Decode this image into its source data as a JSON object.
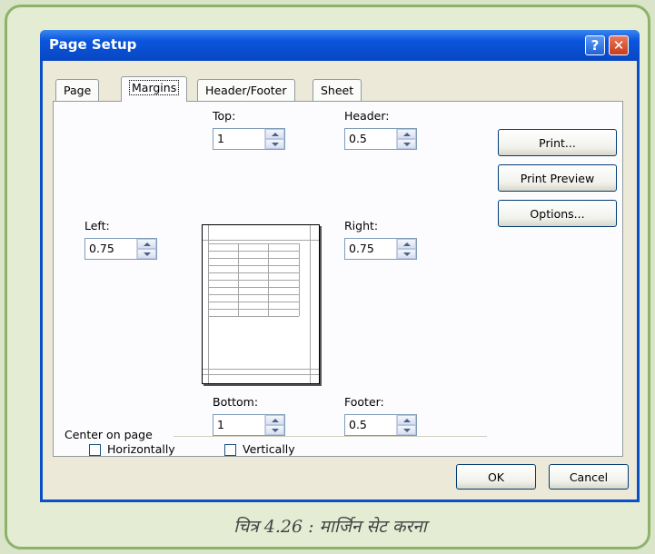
{
  "window": {
    "title": "Page Setup",
    "help_button": "?",
    "close_button": "✕"
  },
  "tabs": [
    {
      "label": "Page",
      "active": false
    },
    {
      "label": "Margins",
      "active": true
    },
    {
      "label": "Header/Footer",
      "active": false
    },
    {
      "label": "Sheet",
      "active": false
    }
  ],
  "margins": {
    "top_label": "Top:",
    "top_value": "1",
    "header_label": "Header:",
    "header_value": "0.5",
    "left_label": "Left:",
    "left_value": "0.75",
    "right_label": "Right:",
    "right_value": "0.75",
    "bottom_label": "Bottom:",
    "bottom_value": "1",
    "footer_label": "Footer:",
    "footer_value": "0.5"
  },
  "side_buttons": {
    "print": "Print...",
    "print_preview": "Print Preview",
    "options": "Options..."
  },
  "center_on_page": {
    "group_label": "Center on page",
    "horizontally": "Horizontally",
    "horizontally_checked": false,
    "vertically": "Vertically",
    "vertically_checked": false
  },
  "footer_buttons": {
    "ok": "OK",
    "cancel": "Cancel"
  },
  "caption": "चित्र 4.26 : मार्जिन सेट करना"
}
